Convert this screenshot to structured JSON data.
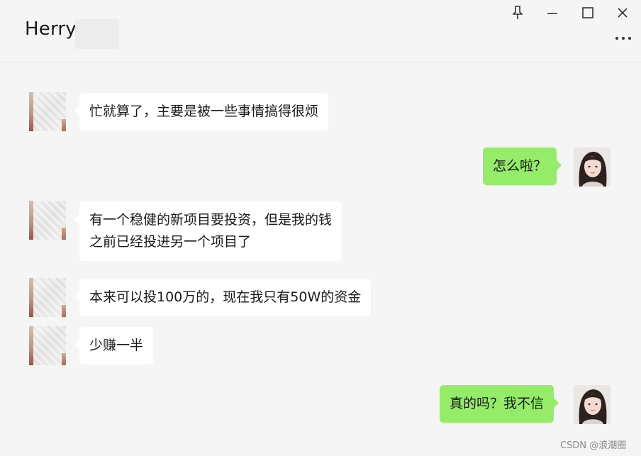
{
  "window": {
    "title": "Herry",
    "controls": [
      "pin-icon",
      "minimize-icon",
      "maximize-icon",
      "close-icon"
    ],
    "more_icon": "more-dots-icon"
  },
  "messages": [
    {
      "from": "contact",
      "lines": [
        "忙就算了，主要是被一些事情搞得很烦"
      ]
    },
    {
      "from": "me",
      "lines": [
        "怎么啦？"
      ]
    },
    {
      "from": "contact",
      "lines": [
        "有一个稳健的新项目要投资，但是我的钱",
        "之前已经投进另一个项目了"
      ]
    },
    {
      "from": "contact",
      "lines": [
        "本来可以投100万的，现在我只有50W的资金"
      ]
    },
    {
      "from": "contact",
      "lines": [
        "少赚一半"
      ]
    },
    {
      "from": "me",
      "lines": [
        "真的吗？我不信"
      ]
    }
  ],
  "colors": {
    "background": "#f5f5f5",
    "incoming_bubble": "#ffffff",
    "outgoing_bubble": "#95ec69"
  },
  "watermark": "CSDN @浪潮圈"
}
